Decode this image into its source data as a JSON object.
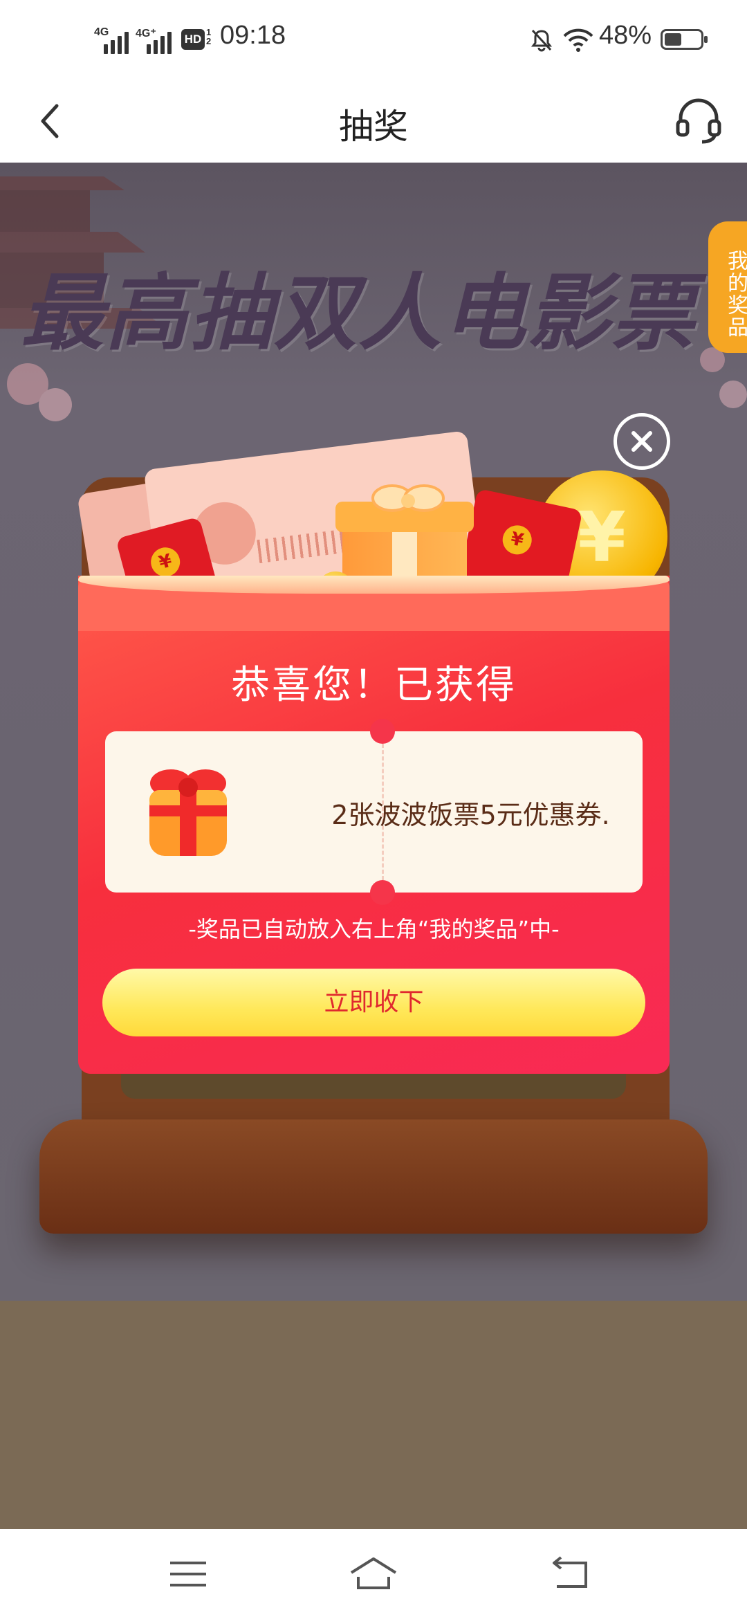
{
  "status_bar": {
    "net1": "4G",
    "net2": "4G⁺",
    "hd": "HD",
    "hd_sub": "1 2",
    "time": "09:18",
    "battery": "48%",
    "battery_level": 0.48
  },
  "header": {
    "title": "抽奖"
  },
  "banner": {
    "headline": "最高抽双人电影票",
    "my_prizes": "我的奖品"
  },
  "illustration": {
    "seal": "¥",
    "coin": "¥"
  },
  "dialog": {
    "congrats": "恭喜您！已获得",
    "prize": "2张波波饭票5元优惠券.",
    "notice": "-奖品已自动放入右上角“我的奖品”中-",
    "accept_button": "立即收下"
  },
  "colors": {
    "card": "#f72f3d",
    "button": "#ffe85a",
    "button_text": "#e0282e",
    "side_tab": "#f6a623"
  }
}
